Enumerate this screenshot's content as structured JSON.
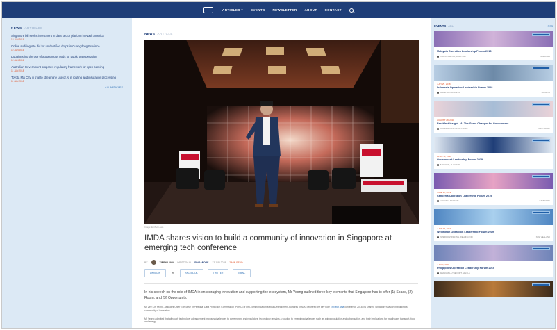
{
  "nav": {
    "items": [
      "ARTICLES ▾",
      "EVENTS",
      "NEWSLETTER",
      "ABOUT",
      "CONTACT"
    ]
  },
  "left": {
    "section": "NEWS",
    "section_sub": "ARTICLES",
    "items": [
      {
        "title": "Singapore bill seeks investment in data sector platform in North America",
        "date": "12 JUN 2018"
      },
      {
        "title": "Online auditing site bid for unidentified drops in Guangdong Province",
        "date": "12 JUN 2018"
      },
      {
        "title": "Dubai testing the use of autonomous pods for public transportation",
        "date": "12 JUN 2018"
      },
      {
        "title": "Australian Government proposes regulatory framework for open banking",
        "date": "11 JUN 2018"
      },
      {
        "title": "Toyota Mai City in trial to streamline use of AI in routing and insurance processing",
        "date": "11 JUN 2018"
      }
    ],
    "all_articles": "ALL ARTICLES"
  },
  "main": {
    "section": "NEWS",
    "section_sub": "ARTICLE",
    "caption": "Image: EmTech Asia",
    "headline": "IMDA shares vision to build a community of innovation in Singapore at emerging tech conference",
    "byline": {
      "by": "BY",
      "author": "YIREN LUNA",
      "location_prefix": "WRITTEN IN",
      "location": "SINGAPORE",
      "date": "12 JUN 2018",
      "time": "2 MIN READ"
    },
    "share": [
      "LINKEDIN",
      "FACEBOOK",
      "TWITTER",
      "EMAIL"
    ],
    "share_close": "✕",
    "lead": "In his speech on the role of IMDA in encouraging innovation and supporting the ecosystem, Mr Yeong outlined three key elements that Singapore has to offer (1) Space, (2) Room, and (3) Opportunity.",
    "para1_a": "Mr Zee Kin Yeong, Assistant Chief Executive of Personal Data Protection Commission (PDPC) of Info-communication Media Development Authority (IMDA) delivered the key note ",
    "para1_link": "EmTech Asia",
    "para1_b": " conference 2018, by sharing Singapore's vision in building a community of innovation.",
    "para2": "Mr Yeong admitted that although technology advancement imposes challenges to government and regulators, technology remains a solution to emerging challenges such as aging population and urbanisation, and their implications for healthcare, transport, food and energy."
  },
  "right": {
    "section": "EVENTS",
    "section_sub": "ALL",
    "rss": "RSS",
    "events": [
      {
        "date": "",
        "title": "Malaysia Operation Leadership Forum 2018",
        "loc": "KUALA LUMPUR, MALAYSIA",
        "tag": "MALAYSIA",
        "c1": "#8a6fb5",
        "c2": "#d1b3d9"
      },
      {
        "date": "JULY 25, 2018",
        "title": "Indonesia Operation Leadership Forum 2018",
        "loc": "JAKARTA, INDONESIA",
        "tag": "JAKARTA",
        "c1": "#b7cde3",
        "c2": "#6d8aa8"
      },
      {
        "date": "AUGUST 28, 2018",
        "title": "Breakfast Insight - AI The Game Changer for Government",
        "loc": "WONDER HOTEL SINGAPORE",
        "tag": "SINGAPORE",
        "c1": "#e9d2d8",
        "c2": "#a7bdd6"
      },
      {
        "date": "APRIL 11, 2019",
        "title": "Government Leadership Forum 2019",
        "loc": "BANGKOK, THAILAND",
        "tag": "",
        "c1": "#dfe8f2",
        "c2": "#1f3e78"
      },
      {
        "date": "JUNE 11, 2019",
        "title": "Canberra Operation Leadership Forum 2019",
        "loc": "NATIONAL MUSEUM",
        "tag": "CANBERRA",
        "c1": "#7a5bb0",
        "c2": "#e7a3c4"
      },
      {
        "date": "JUNE 24, 2019",
        "title": "Wellington Operation Leadership Forum 2019",
        "loc": "INTERCONTINENTAL WELLINGTON",
        "tag": "NEW ZEALAND",
        "c1": "#4f86c2",
        "c2": "#a9d0ee"
      },
      {
        "date": "JULY 4, 2019",
        "title": "Philippines Operation Leadership Forum 2019",
        "loc": "SHANGRI-LA THE FORT, MANILA",
        "tag": "",
        "c1": "#6f84b8",
        "c2": "#c2b1d8"
      },
      {
        "date": "",
        "title": "",
        "loc": "",
        "tag": "",
        "c1": "#3d2c1c",
        "c2": "#b97a3a"
      }
    ]
  }
}
